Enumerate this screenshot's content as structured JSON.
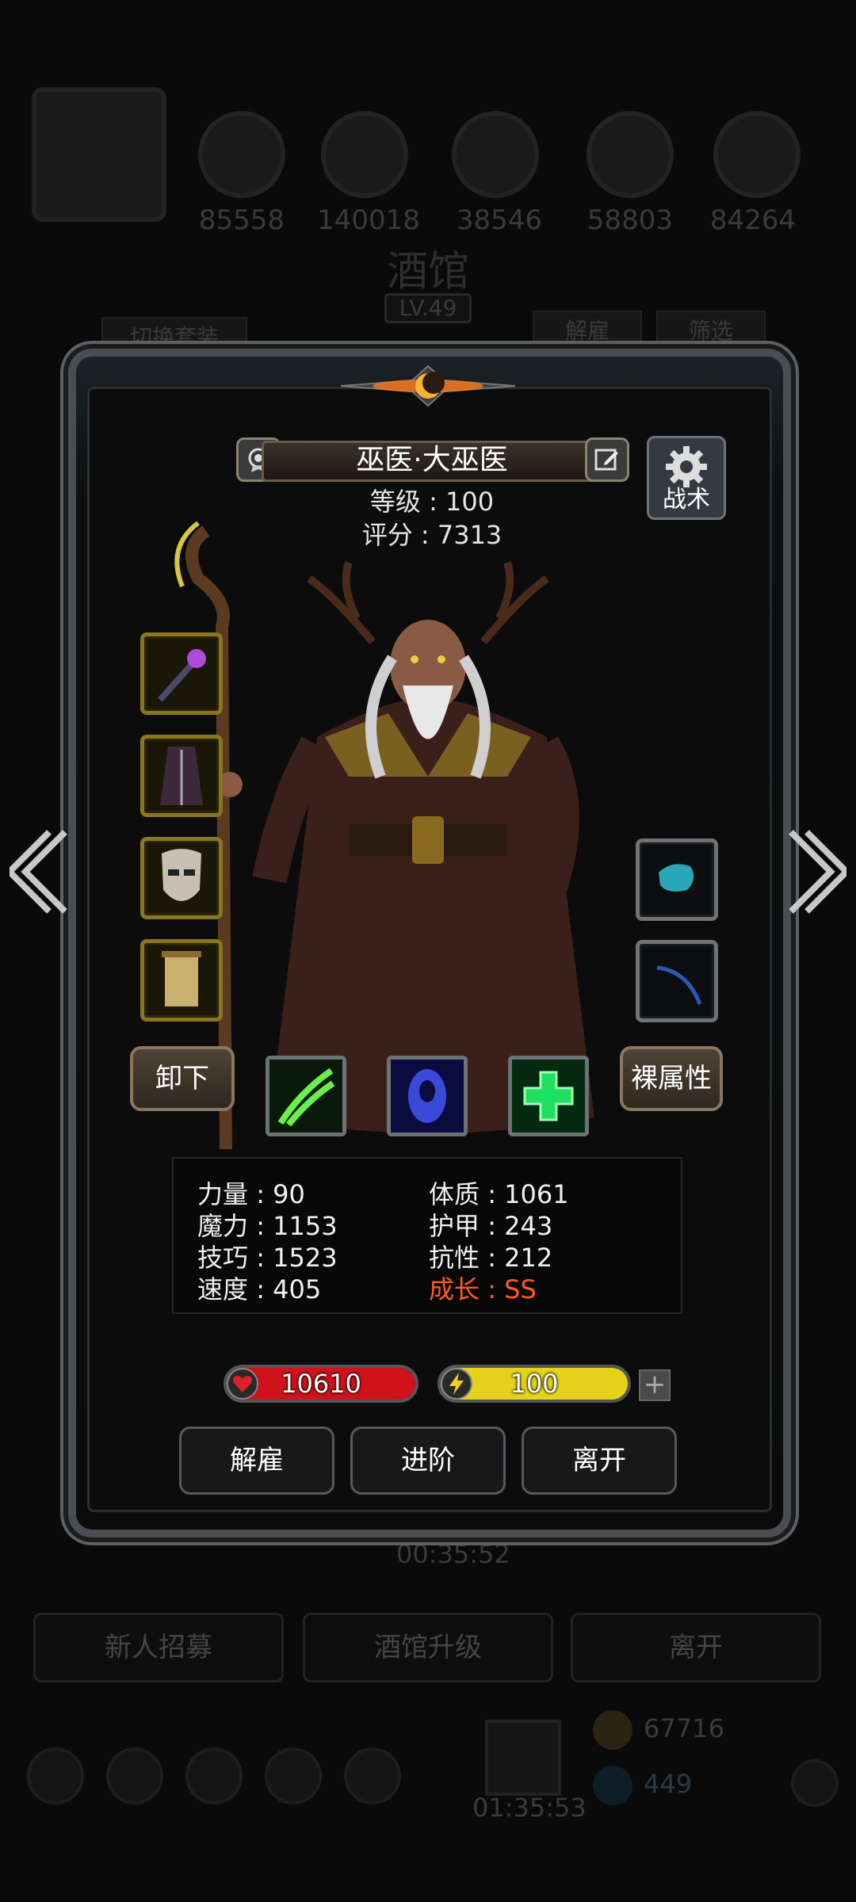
{
  "background": {
    "resources": [
      "85558",
      "140018",
      "38546",
      "58803",
      "84264"
    ],
    "title": "酒馆",
    "level": "LV.49",
    "switch_outfit": "切换套装",
    "dismiss": "解雇",
    "filter": "筛选",
    "timer_top": "00:35:52",
    "recruit": "新人招募",
    "upgrade": "酒馆升级",
    "leave": "离开",
    "timer_bottom": "01:35:53",
    "gold": "67716",
    "gems": "449"
  },
  "hero": {
    "name": "巫医·大巫医",
    "level_label": "等级",
    "level": "100",
    "score_label": "评分",
    "score": "7313",
    "tactics_label": "战术",
    "unequip_label": "卸下",
    "bare_attr_label": "裸属性"
  },
  "equipment": {
    "left": [
      "staff-icon",
      "robe-icon",
      "mask-icon",
      "scroll-icon"
    ],
    "right": [
      "gem-icon",
      "feather-icon"
    ]
  },
  "skills": [
    "green-claw-icon",
    "blue-spirit-icon",
    "green-cross-icon"
  ],
  "stats": {
    "str_label": "力量",
    "str": "90",
    "mag_label": "魔力",
    "mag": "1153",
    "skl_label": "技巧",
    "skl": "1523",
    "spd_label": "速度",
    "spd": "405",
    "con_label": "体质",
    "con": "1061",
    "arm_label": "护甲",
    "arm": "243",
    "res_label": "抗性",
    "res": "212",
    "grow_label": "成长",
    "grow": "SS"
  },
  "bars": {
    "hp": "10610",
    "hp_fill": 1.0,
    "energy": "100",
    "energy_fill": 1.0,
    "hp_color": "#d0121b",
    "energy_color": "#e6d21a"
  },
  "actions": {
    "dismiss": "解雇",
    "advance": "进阶",
    "leave": "离开"
  },
  "colors": {
    "growth": "#ff5a1e",
    "gold_frame": "#8a7520"
  }
}
